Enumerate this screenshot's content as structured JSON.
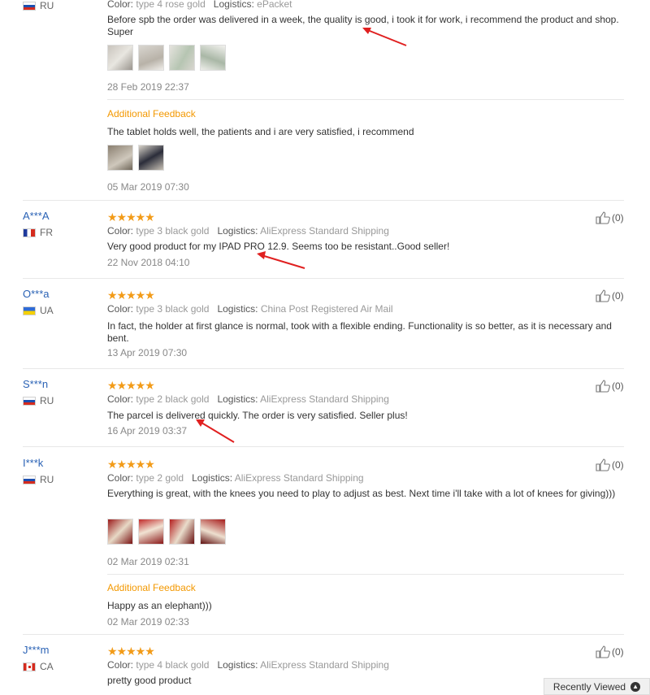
{
  "reviews": [
    {
      "country": "RU",
      "color_label": "Color:",
      "color": "type 4 rose gold",
      "logistics_label": "Logistics:",
      "logistics": "ePacket",
      "text": "Before spb the order was delivered in a week, the quality is good, i took it for work, i recommend the product and shop. Super",
      "date": "28 Feb 2019 22:37",
      "additional_title": "Additional Feedback",
      "additional_text": "The tablet holds well, the patients and i are very satisfied, i recommend",
      "additional_date": "05 Mar 2019 07:30"
    },
    {
      "user": "A***A",
      "country": "FR",
      "stars": "★★★★★",
      "color_label": "Color:",
      "color": "type 3 black gold",
      "logistics_label": "Logistics:",
      "logistics": "AliExpress Standard Shipping",
      "text": "Very good product for my IPAD PRO 12.9. Seems too be resistant..Good seller!",
      "date": "22 Nov 2018 04:10",
      "likes": "(0)"
    },
    {
      "user": "O***a",
      "country": "UA",
      "stars": "★★★★★",
      "color_label": "Color:",
      "color": "type 3 black gold",
      "logistics_label": "Logistics:",
      "logistics": "China Post Registered Air Mail",
      "text": "In fact, the holder at first glance is normal, took with a flexible ending. Functionality is so better, as it is necessary and bent.",
      "date": "13 Apr 2019 07:30",
      "likes": "(0)"
    },
    {
      "user": "S***n",
      "country": "RU",
      "stars": "★★★★★",
      "color_label": "Color:",
      "color": "type 2 black gold",
      "logistics_label": "Logistics:",
      "logistics": "AliExpress Standard Shipping",
      "text": "The parcel is delivered quickly. The order is very satisfied. Seller plus!",
      "date": "16 Apr 2019 03:37",
      "likes": "(0)"
    },
    {
      "user": "I***k",
      "country": "RU",
      "stars": "★★★★★",
      "color_label": "Color:",
      "color": "type 2 gold",
      "logistics_label": "Logistics:",
      "logistics": "AliExpress Standard Shipping",
      "text": "Everything is great, with the knees you need to play to adjust as best. Next time i'll take with a lot of knees for giving)))",
      "date": "02 Mar 2019 02:31",
      "likes": "(0)",
      "additional_title": "Additional Feedback",
      "additional_text": "Happy as an elephant)))",
      "additional_date": "02 Mar 2019 02:33"
    },
    {
      "user": "J***m",
      "country": "CA",
      "stars": "★★★★★",
      "color_label": "Color:",
      "color": "type 4 black gold",
      "logistics_label": "Logistics:",
      "logistics": "AliExpress Standard Shipping",
      "text": "pretty good product",
      "likes": "(0)"
    }
  ],
  "recently_viewed": "Recently Viewed",
  "colors": {
    "link": "#2a62b5",
    "star": "#f29b18",
    "additional": "#f39800",
    "annotation_arrow": "#e02020"
  }
}
